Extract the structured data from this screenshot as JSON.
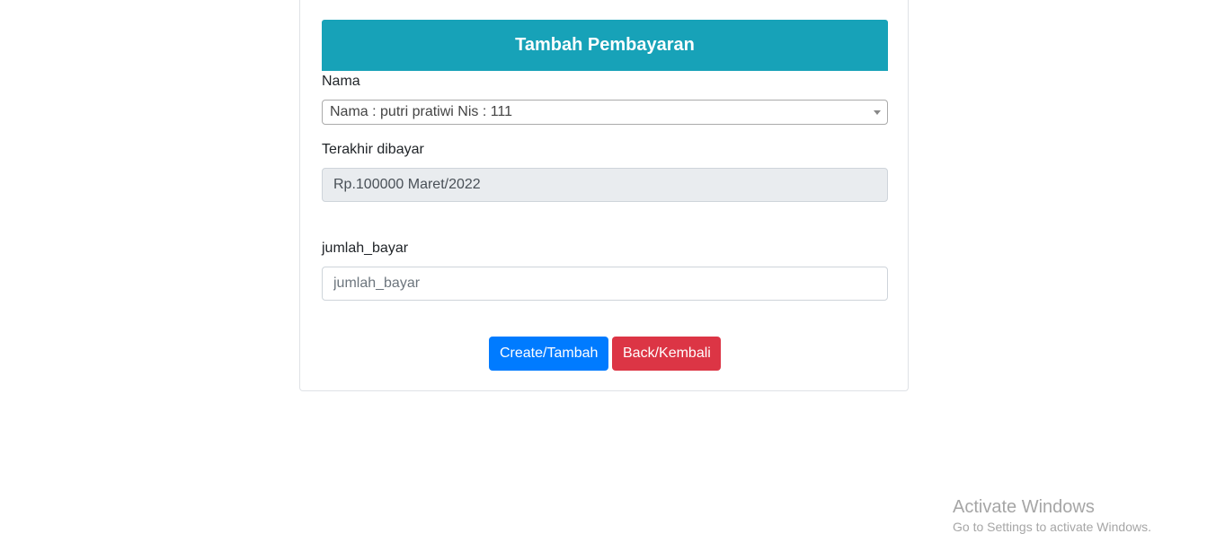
{
  "form": {
    "title": "Tambah Pembayaran",
    "nama_label": "Nama",
    "nama_selected": "Nama : putri pratiwi Nis : 111",
    "terakhir_label": "Terakhir dibayar",
    "terakhir_value": "Rp.100000 Maret/2022",
    "jumlah_label": "jumlah_bayar",
    "jumlah_placeholder": "jumlah_bayar",
    "create_label": "Create/Tambah",
    "back_label": "Back/Kembali"
  },
  "colors": {
    "header": "#17a2b8",
    "primary": "#007bff",
    "danger": "#dc3545"
  },
  "watermark": {
    "line1": "Activate Windows",
    "line2": "Go to Settings to activate Windows."
  }
}
